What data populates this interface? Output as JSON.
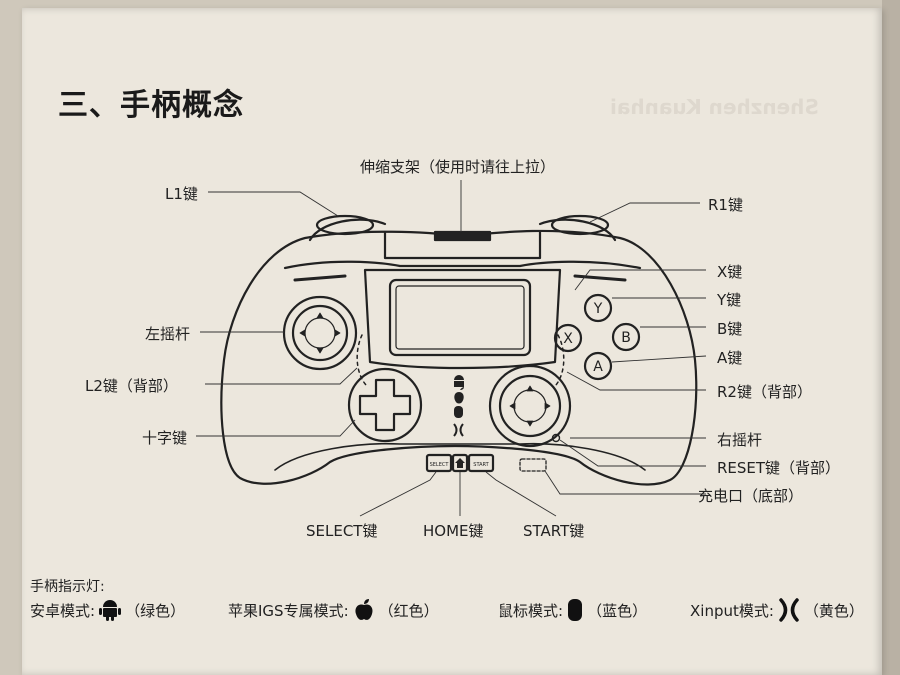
{
  "title": "三、手柄概念",
  "labels": {
    "telescopic": "伸缩支架（使用时请往上拉）",
    "l1": "L1键",
    "r1": "R1键",
    "x": "X键",
    "y": "Y键",
    "b": "B键",
    "a": "A键",
    "left_stick": "左摇杆",
    "l2": "L2键（背部）",
    "r2": "R2键（背部）",
    "dpad": "十字键",
    "right_stick": "右摇杆",
    "reset": "RESET键（背部）",
    "charge": "充电口（底部）",
    "select": "SELECT键",
    "home": "HOME键",
    "start": "START键"
  },
  "buttons_on_pad": {
    "x": "X",
    "y": "Y",
    "b": "B",
    "a": "A",
    "select": "SELECT",
    "start": "START"
  },
  "indicator": {
    "heading": "手柄指示灯:",
    "modes": [
      {
        "label": "安卓模式:",
        "icon": "android-icon",
        "color_text": "（绿色）"
      },
      {
        "label": "苹果IGS专属模式:",
        "icon": "apple-icon",
        "color_text": "（红色）"
      },
      {
        "label": "鼠标模式:",
        "icon": "mouse-icon",
        "color_text": "（蓝色）"
      },
      {
        "label": "Xinput模式:",
        "icon": "xinput-icon",
        "color_text": "（黄色）"
      }
    ]
  }
}
